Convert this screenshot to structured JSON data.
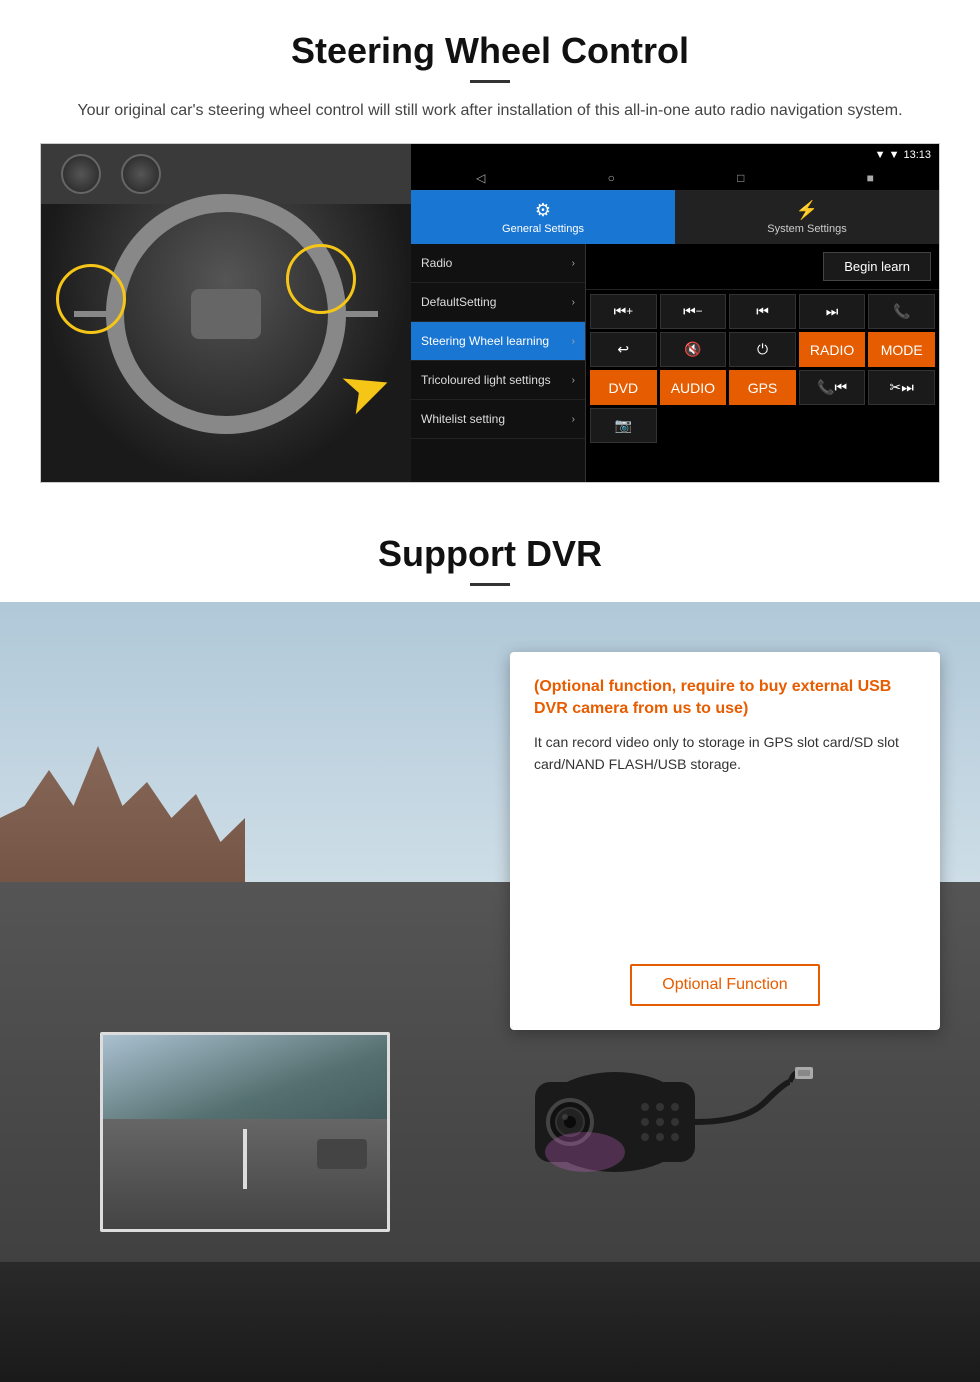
{
  "steering": {
    "title": "Steering Wheel Control",
    "description": "Your original car's steering wheel control will still work after installation of this all-in-one auto radio navigation system.",
    "ui": {
      "statusbar": {
        "time": "13:13",
        "signal_icon": "▲",
        "wifi_icon": "▼"
      },
      "tabs": {
        "general": {
          "icon": "⚙",
          "label": "General Settings"
        },
        "system": {
          "icon": "⚡",
          "label": "System Settings"
        }
      },
      "menu_items": [
        {
          "label": "Radio",
          "active": false
        },
        {
          "label": "DefaultSetting",
          "active": false
        },
        {
          "label": "Steering Wheel learning",
          "active": true
        },
        {
          "label": "Tricoloured light settings",
          "active": false
        },
        {
          "label": "Whitelist setting",
          "active": false
        }
      ],
      "begin_learn": "Begin learn",
      "control_buttons": [
        {
          "icon": "⏮+",
          "label": "vol_up"
        },
        {
          "icon": "⏮–",
          "label": "vol_down"
        },
        {
          "icon": "⏮",
          "label": "prev"
        },
        {
          "icon": "⏭",
          "label": "next"
        },
        {
          "icon": "📞",
          "label": "phone"
        },
        {
          "icon": "↩",
          "label": "back"
        },
        {
          "icon": "🔇×",
          "label": "mute"
        },
        {
          "icon": "⏻",
          "label": "power"
        },
        {
          "icon": "RADIO",
          "label": "radio"
        },
        {
          "icon": "MODE",
          "label": "mode"
        },
        {
          "icon": "DVD",
          "label": "dvd"
        },
        {
          "icon": "AUDIO",
          "label": "audio"
        },
        {
          "icon": "GPS",
          "label": "gps"
        },
        {
          "icon": "📞⏮",
          "label": "phone_prev"
        },
        {
          "icon": "✂⏭",
          "label": "phone_next"
        },
        {
          "icon": "📷",
          "label": "camera"
        }
      ]
    }
  },
  "dvr": {
    "title": "Support DVR",
    "optional_text": "(Optional function, require to buy external USB DVR camera from us to use)",
    "description": "It can record video only to storage in GPS slot card/SD slot card/NAND FLASH/USB storage.",
    "optional_button": "Optional Function"
  }
}
